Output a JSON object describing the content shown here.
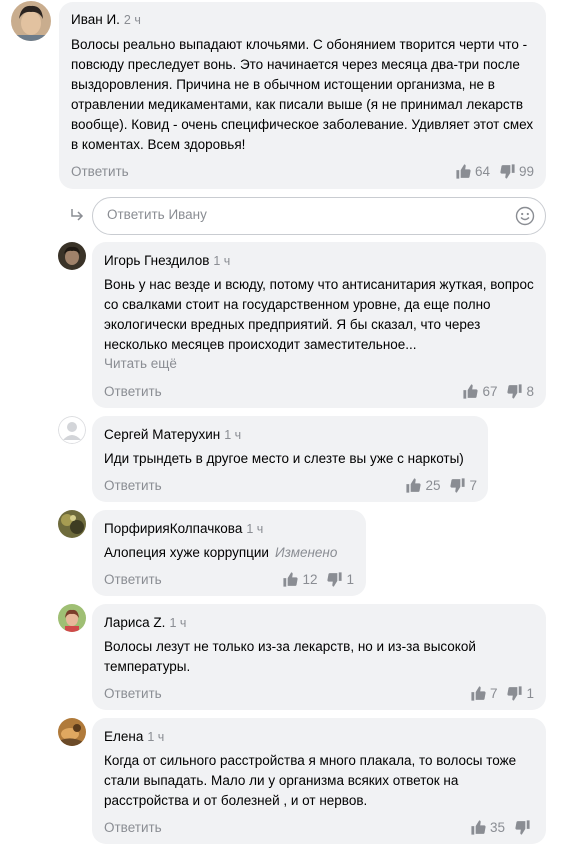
{
  "reply_box": {
    "placeholder": "Ответить Ивану"
  },
  "comments": [
    {
      "author": "Иван И.",
      "time": "2 ч",
      "text": "Волосы реально выпадают клочьями. С обонянием творится черти что - повсюду преследует вонь. Это начинается через месяца два-три после выздоровления. Причина не в обычном истощении организма, не в отравлении медикаментами, как писали выше (я не принимал лекарств вообще). Ковид - очень специфическое заболевание. Удивляет этот смех в коментах. Всем здоровья!",
      "reply": "Ответить",
      "likes": "64",
      "dislikes": "99"
    },
    {
      "author": "Игорь Гнездилов",
      "time": "1 ч",
      "text": "Вонь у нас везде и всюду, потому что антисанитария жуткая, вопрос со свалками стоит на государственном уровне, да еще полно экологически вредных предприятий. Я бы сказал, что через несколько месяцев происходит заместительное...",
      "read_more": "Читать ещё",
      "reply": "Ответить",
      "likes": "67",
      "dislikes": "8"
    },
    {
      "author": "Сергей Матерухин",
      "time": "1 ч",
      "text": "Иди трындеть в другое место и слезте вы уже с наркоты)",
      "reply": "Ответить",
      "likes": "25",
      "dislikes": "7"
    },
    {
      "author": "ПорфирияКолпачкова",
      "time": "1 ч",
      "text": "Алопеция хуже коррупции",
      "edited": "Изменено",
      "reply": "Ответить",
      "likes": "12",
      "dislikes": "1"
    },
    {
      "author": "Лариса Z.",
      "time": "1 ч",
      "text": "Волосы лезут не только из-за лекарств, но и из-за высокой температуры.",
      "reply": "Ответить",
      "likes": "7",
      "dislikes": "1"
    },
    {
      "author": "Елена",
      "time": "1 ч",
      "text": "Когда от сильного расстройства я много плакала, то волосы тоже стали выпадать. Мало ли у организма всяких ответок на расстройства и от болезней , и от нервов.",
      "reply": "Ответить",
      "likes": "35",
      "dislikes": ""
    }
  ],
  "colors": {
    "bubble": "#f1f2f4",
    "muted": "#8a8d93",
    "text": "#000000"
  }
}
